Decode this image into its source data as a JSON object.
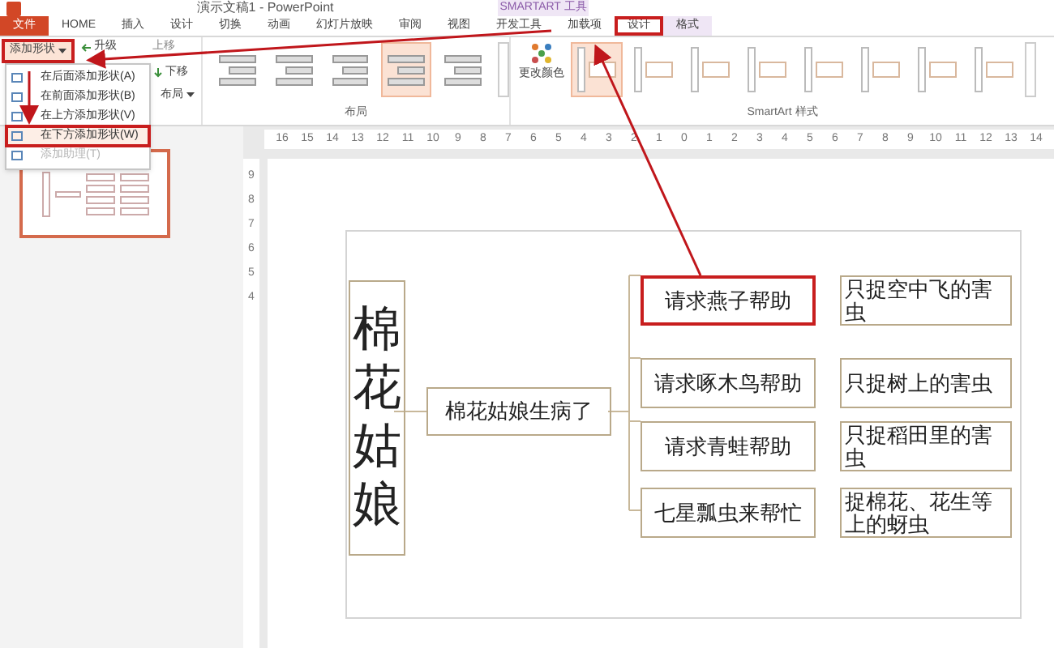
{
  "window": {
    "title": "演示文稿1 - PowerPoint"
  },
  "contextual_group": {
    "label": "SMARTART 工具"
  },
  "tabs": [
    {
      "label": "文件",
      "kind": "file",
      "selected": false
    },
    {
      "label": "HOME",
      "kind": "normal",
      "selected": false
    },
    {
      "label": "插入",
      "kind": "normal",
      "selected": false
    },
    {
      "label": "设计",
      "kind": "normal",
      "selected": false
    },
    {
      "label": "切换",
      "kind": "normal",
      "selected": false
    },
    {
      "label": "动画",
      "kind": "normal",
      "selected": false
    },
    {
      "label": "幻灯片放映",
      "kind": "normal",
      "selected": false
    },
    {
      "label": "审阅",
      "kind": "normal",
      "selected": false
    },
    {
      "label": "视图",
      "kind": "normal",
      "selected": false
    },
    {
      "label": "开发工具",
      "kind": "normal",
      "selected": false
    },
    {
      "label": "加载项",
      "kind": "normal",
      "selected": false
    },
    {
      "label": "设计",
      "kind": "contextual",
      "selected": true
    },
    {
      "label": "格式",
      "kind": "contextual",
      "selected": false
    }
  ],
  "ribbon": {
    "add_shape": {
      "label": "添加形状",
      "pressed": true
    },
    "buttons": [
      {
        "label": "升级"
      },
      {
        "label": "上移"
      },
      {
        "label": "下移"
      },
      {
        "label": "布局"
      }
    ],
    "layout_gallery": {
      "label": "布局",
      "items": [
        {
          "selected": false
        },
        {
          "selected": false
        },
        {
          "selected": false
        },
        {
          "selected": true
        },
        {
          "selected": false
        }
      ]
    },
    "change_colors": {
      "label": "更改颜色"
    },
    "style_gallery": {
      "label": "SmartArt 样式",
      "items": [
        {
          "selected": true
        },
        {
          "selected": false
        },
        {
          "selected": false
        },
        {
          "selected": false
        },
        {
          "selected": false
        },
        {
          "selected": false
        },
        {
          "selected": false
        },
        {
          "selected": false
        }
      ]
    }
  },
  "dropdown_menu": {
    "items": [
      {
        "label": "在后面添加形状(A)",
        "disabled": false,
        "selected": false
      },
      {
        "label": "在前面添加形状(B)",
        "disabled": false,
        "selected": false
      },
      {
        "label": "在上方添加形状(V)",
        "disabled": false,
        "selected": false
      },
      {
        "label": "在下方添加形状(W)",
        "disabled": false,
        "selected": true
      },
      {
        "label": "添加助理(T)",
        "disabled": true,
        "selected": false
      }
    ]
  },
  "ruler": {
    "horizontal": [
      "16",
      "15",
      "14",
      "13",
      "12",
      "11",
      "10",
      "9",
      "8",
      "7",
      "6",
      "5",
      "4",
      "3",
      "2",
      "1",
      "0",
      "1",
      "2",
      "3",
      "4",
      "5",
      "6",
      "7",
      "8",
      "9",
      "10",
      "11",
      "12",
      "13",
      "14"
    ],
    "vertical": [
      "9",
      "8",
      "7",
      "6",
      "5",
      "4"
    ]
  },
  "slide_thumbnails": [
    {
      "selected": true
    }
  ],
  "diagram": {
    "title": "棉花姑娘",
    "center": "棉花姑娘生病了",
    "branches": [
      {
        "helper": "请求燕子帮助",
        "task": "只捉空中飞的害虫",
        "selected": true
      },
      {
        "helper": "请求啄木鸟帮助",
        "task": "只捉树上的害虫",
        "selected": false
      },
      {
        "helper": "请求青蛙帮助",
        "task": "只捉稻田里的害虫",
        "selected": false
      },
      {
        "helper": "七星瓢虫来帮忙",
        "task": "捉棉花、花生等上的蚜虫",
        "selected": false
      }
    ]
  }
}
